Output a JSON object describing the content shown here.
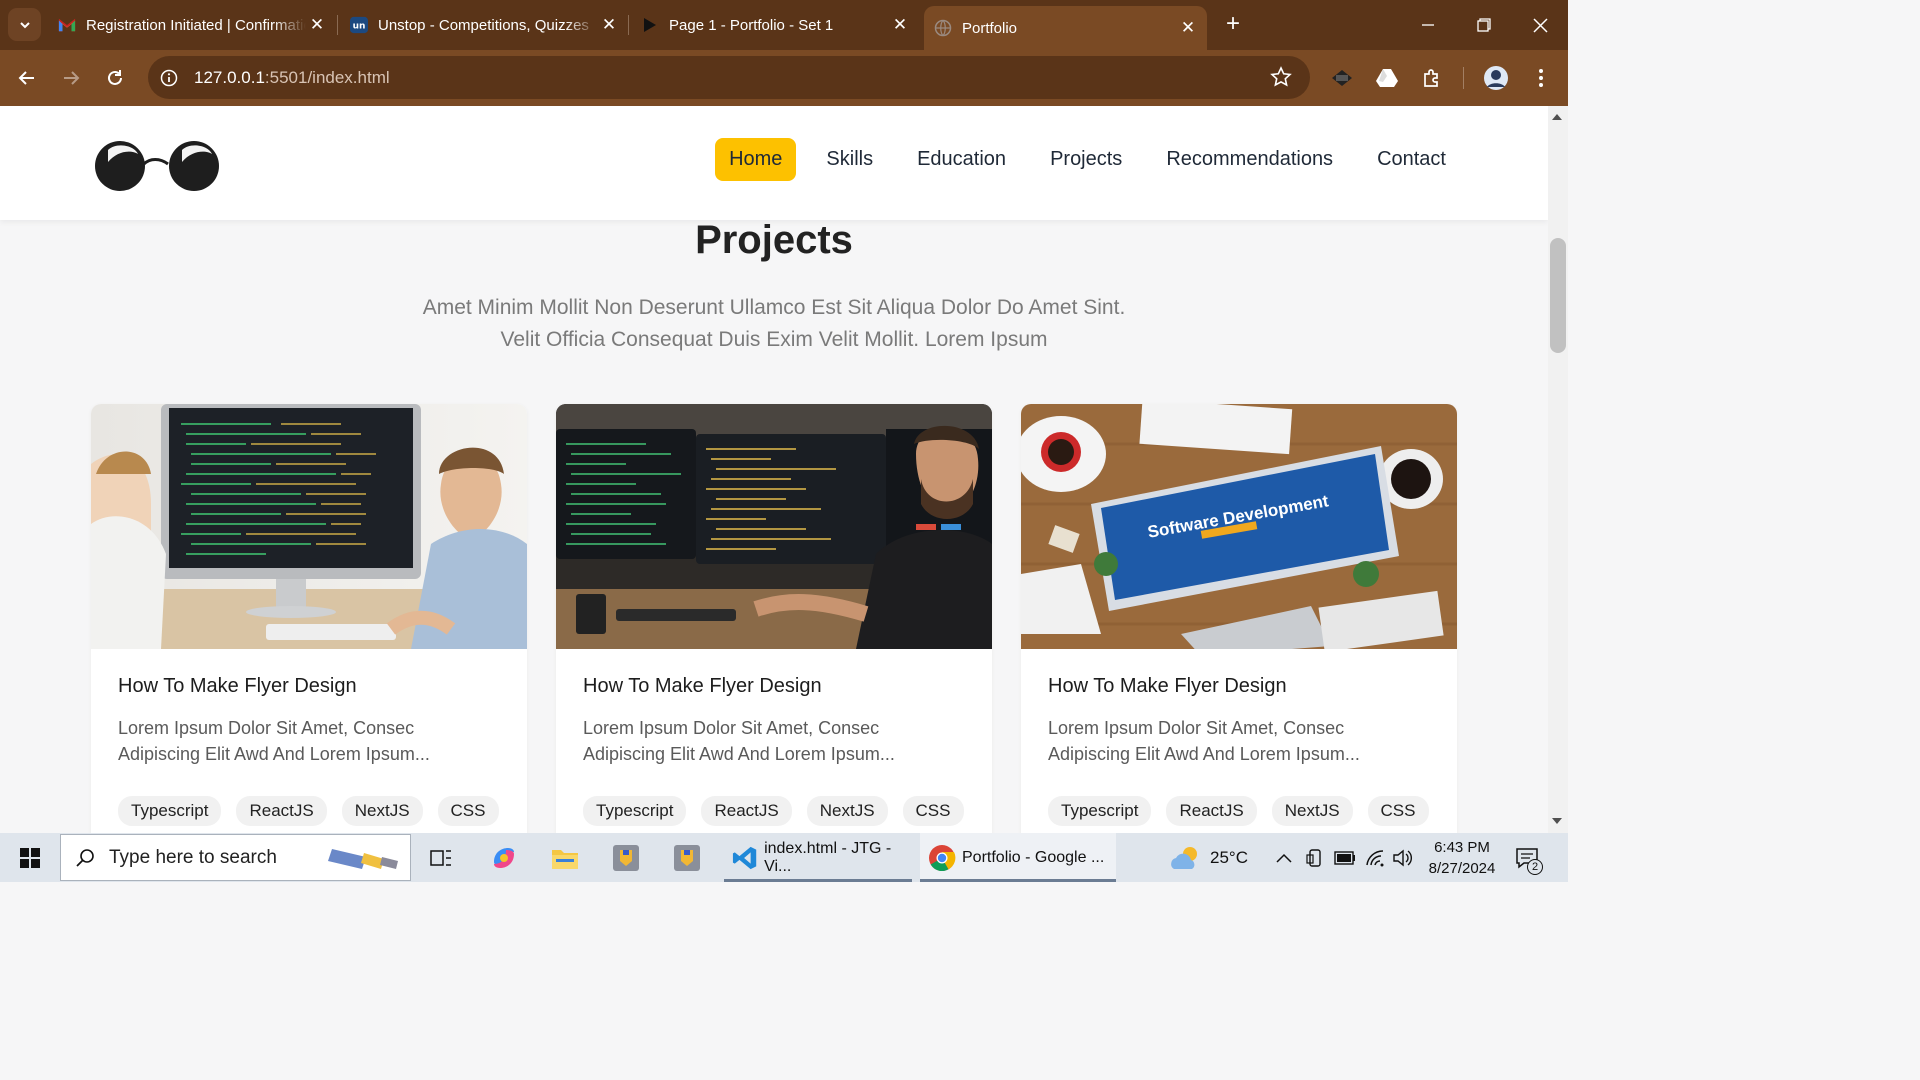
{
  "browser": {
    "tabs": [
      {
        "title": "Registration Initiated | Confirmation",
        "icon": "gmail-icon",
        "active": false
      },
      {
        "title": "Unstop - Competitions, Quizzes",
        "icon": "unstop-icon",
        "active": false
      },
      {
        "title": "Page 1 - Portfolio - Set 1",
        "icon": "play-icon",
        "active": false
      },
      {
        "title": "Portfolio",
        "icon": "globe-icon",
        "active": true
      }
    ],
    "url_host": "127.0.0.1",
    "url_rest": ":5501/index.html"
  },
  "site": {
    "nav": [
      {
        "label": "Home",
        "active": true
      },
      {
        "label": "Skills",
        "active": false
      },
      {
        "label": "Education",
        "active": false
      },
      {
        "label": "Projects",
        "active": false
      },
      {
        "label": "Recommendations",
        "active": false
      },
      {
        "label": "Contact",
        "active": false
      }
    ],
    "section_title": "Projects",
    "section_sub_line1": "Amet Minim Mollit Non Deserunt Ullamco Est Sit Aliqua Dolor Do Amet Sint.",
    "section_sub_line2": "Velit Officia Consequat Duis Exim Velit Mollit. Lorem Ipsum",
    "cards": [
      {
        "title": "How To Make Flyer Design",
        "desc_line1": "Lorem Ipsum Dolor Sit Amet, Consec",
        "desc_line2": "Adipiscing Elit Awd And Lorem Ipsum...",
        "tags": [
          "Typescript",
          "ReactJS",
          "NextJS",
          "CSS"
        ]
      },
      {
        "title": "How To Make Flyer Design",
        "desc_line1": "Lorem Ipsum Dolor Sit Amet, Consec",
        "desc_line2": "Adipiscing Elit Awd And Lorem Ipsum...",
        "tags": [
          "Typescript",
          "ReactJS",
          "NextJS",
          "CSS"
        ]
      },
      {
        "title": "How To Make Flyer Design",
        "desc_line1": "Lorem Ipsum Dolor Sit Amet, Consec",
        "desc_line2": "Adipiscing Elit Awd And Lorem Ipsum...",
        "tags": [
          "Typescript",
          "ReactJS",
          "NextJS",
          "CSS"
        ],
        "image_text": "Software Development"
      }
    ]
  },
  "taskbar": {
    "search_placeholder": "Type here to search",
    "apps": [
      {
        "label": "index.html - JTG - Vi...",
        "icon": "vscode-icon"
      },
      {
        "label": "Portfolio - Google ...",
        "icon": "chrome-icon"
      }
    ],
    "weather": "25°C",
    "time": "6:43 PM",
    "date": "8/27/2024",
    "notifications": "2"
  },
  "colors": {
    "accent": "#fdc100",
    "chrome_dark": "#5a3418",
    "chrome_light": "#7a4a24"
  }
}
